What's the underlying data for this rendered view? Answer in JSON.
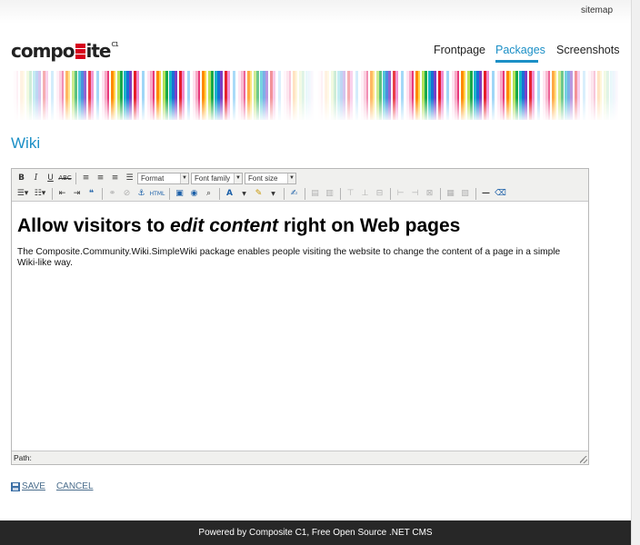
{
  "header": {
    "sitemap_link": "sitemap",
    "logo_left": "compo",
    "logo_right": "ite",
    "logo_sup": "C1",
    "nav": [
      {
        "label": "Frontpage",
        "active": false
      },
      {
        "label": "Packages",
        "active": true
      },
      {
        "label": "Screenshots",
        "active": false
      }
    ]
  },
  "page": {
    "title": "Wiki"
  },
  "editor": {
    "toolbar": {
      "format_select": "Format",
      "font_family_select": "Font family",
      "font_size_select": "Font size",
      "html_button": "HTML"
    },
    "content_heading_before": "Allow visitors to ",
    "content_heading_emph": "edit content",
    "content_heading_after": " right on Web pages",
    "content_paragraph": "The Composite.Community.Wiki.SimpleWiki package enables people visiting the website to change the content of a page in a simple Wiki-like way.",
    "status_path": "Path:"
  },
  "actions": {
    "save": "SAVE",
    "cancel": "CANCEL"
  },
  "footer": {
    "text": "Powered by Composite C1, Free Open Source .NET CMS"
  },
  "colors": {
    "accent": "#1b8fc6",
    "footer_bg": "#272727",
    "logo_red": "#d6001c"
  }
}
